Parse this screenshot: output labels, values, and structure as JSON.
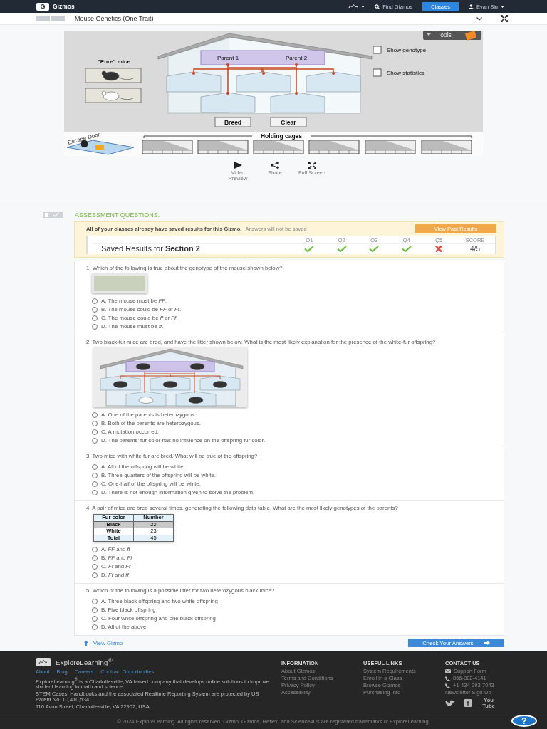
{
  "topbar": {
    "logo_letter": "G",
    "brand": "Gizmos",
    "search": "Find Gizmos",
    "classes": "Classes",
    "user": "Evan Siu"
  },
  "gizmo": {
    "title": "Mouse Genetics (One Trait)",
    "tools": "Tools",
    "pure_label": "\"Pure\" mice",
    "parents": [
      "Parent 1",
      "Parent 2"
    ],
    "options": [
      {
        "label": "Show genotype",
        "checked": false
      },
      {
        "label": "Show statistics",
        "checked": false
      }
    ],
    "buttons": [
      "Breed",
      "Clear"
    ],
    "escape_door": "Escape Door",
    "holding_cages": "Holding cages",
    "controls": [
      {
        "kind": "video",
        "label": "Video Preview"
      },
      {
        "kind": "share",
        "label": "Share"
      },
      {
        "kind": "fullscreen",
        "label": "Full Screen"
      }
    ]
  },
  "assessment": {
    "title": "ASSESSMENT QUESTIONS:",
    "notice": "All of your classes already have saved results for this Gizmo.",
    "notice_note": "Answers will not be saved",
    "past_button": "View Past Results",
    "results": {
      "title": "Saved Results for **Section 2**",
      "score_label": "SCORE",
      "score": "4/5",
      "questions": [
        {
          "label": "Q1",
          "correct": true
        },
        {
          "label": "Q2",
          "correct": true
        },
        {
          "label": "Q3",
          "correct": true
        },
        {
          "label": "Q4",
          "correct": true
        },
        {
          "label": "Q5",
          "correct": false
        }
      ]
    }
  },
  "questions": [
    {
      "text": "1. Which of the following is true about the genotype of the mouse shown below?",
      "figure": {
        "kind": "photo"
      },
      "options": [
        {
          "text": "A. The mouse must be *FF*.",
          "selected": false
        },
        {
          "text": "B. The mouse could be *FF* or *Ff*.",
          "selected": false
        },
        {
          "text": "C. The mouse could be *ff* or *Ff*.",
          "selected": false
        },
        {
          "text": "D. The mouse must be *ff*.",
          "selected": false
        }
      ]
    },
    {
      "text": "2. Two black-fur mice are bred, and have the litter shown below. What is the most likely explanation for the presence of the white-fur offspring?",
      "figure": {
        "kind": "litter"
      },
      "options": [
        {
          "text": "A. One of the parents is heterozygous.",
          "selected": false
        },
        {
          "text": "B. Both of the parents are heterozygous.",
          "selected": false
        },
        {
          "text": "C. A mutation occurred.",
          "selected": false
        },
        {
          "text": "D. The parents' fur color has no influence on the offspring fur color.",
          "selected": false
        }
      ]
    },
    {
      "text": "3. Two mice with white fur are bred. What will be true of the offspring?",
      "options": [
        {
          "text": "A. All of the offspring will be white.",
          "selected": false
        },
        {
          "text": "B. Three-quarters of the offspring will be white.",
          "selected": false
        },
        {
          "text": "C. One-half of the offspring will be white.",
          "selected": false
        },
        {
          "text": "D. There is not enough information given to solve the problem.",
          "selected": false
        }
      ]
    },
    {
      "text": "4. A pair of mice are bred several times, generating the following data table. What are the most likely genotypes of the parents?",
      "figure": {
        "kind": "table",
        "columns": [
          "Fur color",
          "Number"
        ],
        "rows": [
          [
            "Black",
            "22"
          ],
          [
            "White",
            "23"
          ],
          [
            "Total",
            "45"
          ]
        ]
      },
      "options": [
        {
          "text": "A. *FF* and *ff*",
          "selected": false
        },
        {
          "text": "B. *FF* and *Ff*",
          "selected": false
        },
        {
          "text": "C. *Ff* and *Ff*",
          "selected": false
        },
        {
          "text": "D. *Ff* and *ff*",
          "selected": false
        }
      ]
    },
    {
      "text": "5. Which of the following is a possible litter for two heterozygous black mice?",
      "options": [
        {
          "text": "A. Three black offspring and two white offspring",
          "selected": false
        },
        {
          "text": "B. Five black offspring",
          "selected": false
        },
        {
          "text": "C. Four white offspring and one black offspring",
          "selected": false
        },
        {
          "text": "D. All of the above",
          "selected": false
        }
      ]
    }
  ],
  "actions": {
    "view_gizmo": "View Gizmo",
    "check": "Check Your Answers"
  },
  "footer": {
    "brand": "ExploreLearning$^{®}$",
    "links": [
      "About",
      "Blog",
      "Careers",
      "Contract Opportunities"
    ],
    "paragraphs": [
      "ExploreLearning$^{®}$ is a Charlottesville, VA based company that develops online solutions to improve student learning in math and science.",
      "STEM Cases, Handbooks and the associated Realtime Reporting System are protected by US Patent No. 10,410,534",
      "110 Avon Street, Charlottesville, VA 22902, USA"
    ],
    "columns": [
      {
        "heading": "INFORMATION",
        "items": [
          {
            "text": "About Gizmos"
          },
          {
            "text": "Terms and Conditions"
          },
          {
            "text": "Privacy Policy"
          },
          {
            "text": "Accessibility"
          }
        ]
      },
      {
        "heading": "USEFUL LINKS",
        "items": [
          {
            "text": "System Requirements"
          },
          {
            "text": "Enroll in a Class"
          },
          {
            "text": "Browse Gizmos"
          },
          {
            "text": "Purchasing Info"
          }
        ]
      },
      {
        "heading": "CONTACT US",
        "items": [
          {
            "text": "Support Form",
            "kind": "mail"
          },
          {
            "text": "866-882-4141",
            "kind": "phone"
          },
          {
            "text": "+1-434-293-7043",
            "kind": "phone"
          },
          {
            "text": "Newsletter Sign-Up"
          }
        ]
      }
    ],
    "social": [
      {
        "kind": "bird"
      },
      {
        "kind": "letter",
        "text": "f"
      },
      {
        "kind": "tube",
        "text": "You Tube"
      }
    ],
    "copyright": "© 2024 ExploreLearning. All rights reserved. Gizmo, Gizmos, Reflex, and Science4Us are registered trademarks of ExploreLearning.",
    "help": "?"
  }
}
